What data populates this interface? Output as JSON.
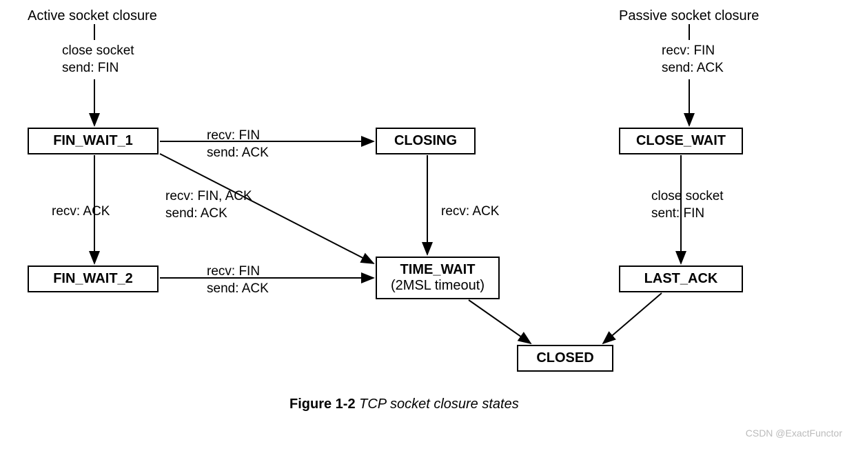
{
  "headers": {
    "active": "Active socket closure",
    "passive": "Passive socket closure"
  },
  "states": {
    "fin_wait_1": "FIN_WAIT_1",
    "fin_wait_2": "FIN_WAIT_2",
    "closing": "CLOSING",
    "time_wait_line1": "TIME_WAIT",
    "time_wait_line2": "(2MSL timeout)",
    "close_wait": "CLOSE_WAIT",
    "last_ack": "LAST_ACK",
    "closed": "CLOSED"
  },
  "edges": {
    "active_start_l1": "close socket",
    "active_start_l2": "send: FIN",
    "passive_start_l1": "recv: FIN",
    "passive_start_l2": "send: ACK",
    "fw1_to_fw2": "recv: ACK",
    "fw1_to_closing_l1": "recv: FIN",
    "fw1_to_closing_l2": "send: ACK",
    "fw1_to_tw_l1": "recv: FIN, ACK",
    "fw1_to_tw_l2": "send: ACK",
    "fw2_to_tw_l1": "recv: FIN",
    "fw2_to_tw_l2": "send: ACK",
    "closing_to_tw": "recv: ACK",
    "cw_to_la_l1": "close socket",
    "cw_to_la_l2": "sent: FIN"
  },
  "caption_bold": "Figure 1-2",
  "caption_italic": "TCP socket closure states",
  "watermark": "CSDN @ExactFunctor"
}
